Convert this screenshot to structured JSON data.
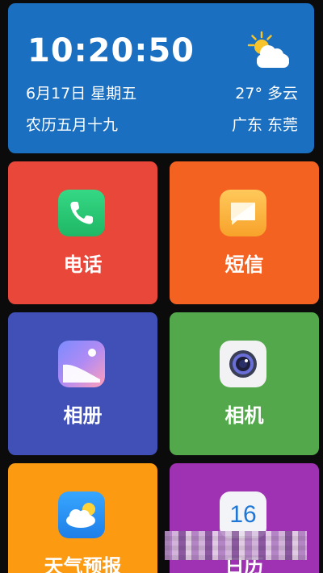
{
  "header": {
    "time": "10:20:50",
    "date": "6月17日 星期五",
    "lunar": "农历五月十九",
    "temperature": "27° 多云",
    "location": "广东 东莞",
    "weather_icon": "partly-cloudy-icon"
  },
  "tiles": [
    {
      "label": "电话",
      "icon": "phone-icon",
      "color": "#e8473a"
    },
    {
      "label": "短信",
      "icon": "message-icon",
      "color": "#f46221"
    },
    {
      "label": "相册",
      "icon": "gallery-icon",
      "color": "#4150b6"
    },
    {
      "label": "相机",
      "icon": "camera-icon",
      "color": "#52a84a"
    },
    {
      "label": "天气预报",
      "icon": "weather-icon",
      "color": "#fc9a12"
    },
    {
      "label": "日历",
      "icon": "calendar-icon",
      "color": "#9e32b3",
      "icon_text": "16"
    }
  ]
}
